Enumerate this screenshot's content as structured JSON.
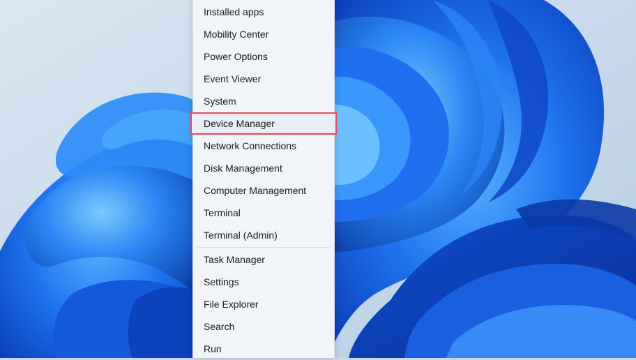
{
  "menu": {
    "group1": [
      {
        "label": "Installed apps"
      },
      {
        "label": "Mobility Center"
      },
      {
        "label": "Power Options"
      },
      {
        "label": "Event Viewer"
      },
      {
        "label": "System"
      },
      {
        "label": "Device Manager",
        "highlighted": true
      },
      {
        "label": "Network Connections"
      },
      {
        "label": "Disk Management"
      },
      {
        "label": "Computer Management"
      },
      {
        "label": "Terminal"
      },
      {
        "label": "Terminal (Admin)"
      }
    ],
    "group2": [
      {
        "label": "Task Manager"
      },
      {
        "label": "Settings"
      },
      {
        "label": "File Explorer"
      },
      {
        "label": "Search"
      },
      {
        "label": "Run"
      }
    ]
  },
  "colors": {
    "wallpaper_bg": "#c9d9e9",
    "bloom_blue": "#1f67e8",
    "highlight_border": "#e84a5a"
  },
  "wallpaper": {
    "icon": "windows-11-bloom"
  }
}
